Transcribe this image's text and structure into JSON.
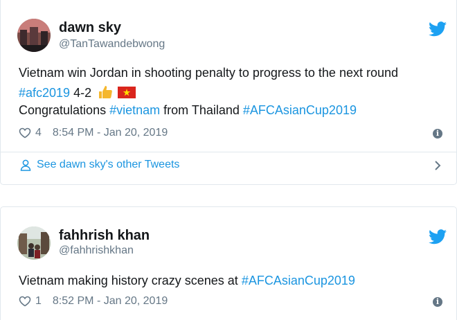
{
  "tweets": [
    {
      "display_name": "dawn sky",
      "handle": "@TanTawandebwong",
      "line1": "Vietnam win Jordan in shooting penalty to progress to the next round",
      "line2_tag": "#afc2019",
      "line2_text": " 4-2",
      "line3_prefix": "Congratulations ",
      "line3_tag1": "#vietnam",
      "line3_mid": " from Thailand ",
      "line3_tag2": "#AFCAsianCup2019",
      "likes": "4",
      "timestamp": "8:54 PM - Jan 20, 2019",
      "see_more": "See dawn sky's other Tweets"
    },
    {
      "display_name": "fahhrish khan",
      "handle": "@fahhrishkhan",
      "line1_text": "Vietnam making history crazy scenes at ",
      "line1_tag": "#AFCAsianCup2019",
      "likes": "1",
      "timestamp": "8:52 PM - Jan 20, 2019"
    }
  ],
  "icons": {
    "bird": "twitter-bird-icon",
    "heart": "heart-icon",
    "info": "info-icon",
    "user": "user-icon",
    "chevron": "chevron-right-icon",
    "thumbs_up": "thumbs-up-emoji",
    "flag": "vietnam-flag-emoji"
  },
  "colors": {
    "link": "#1b95e0",
    "muted": "#657786",
    "text": "#14171a",
    "border": "#e1e8ed"
  }
}
